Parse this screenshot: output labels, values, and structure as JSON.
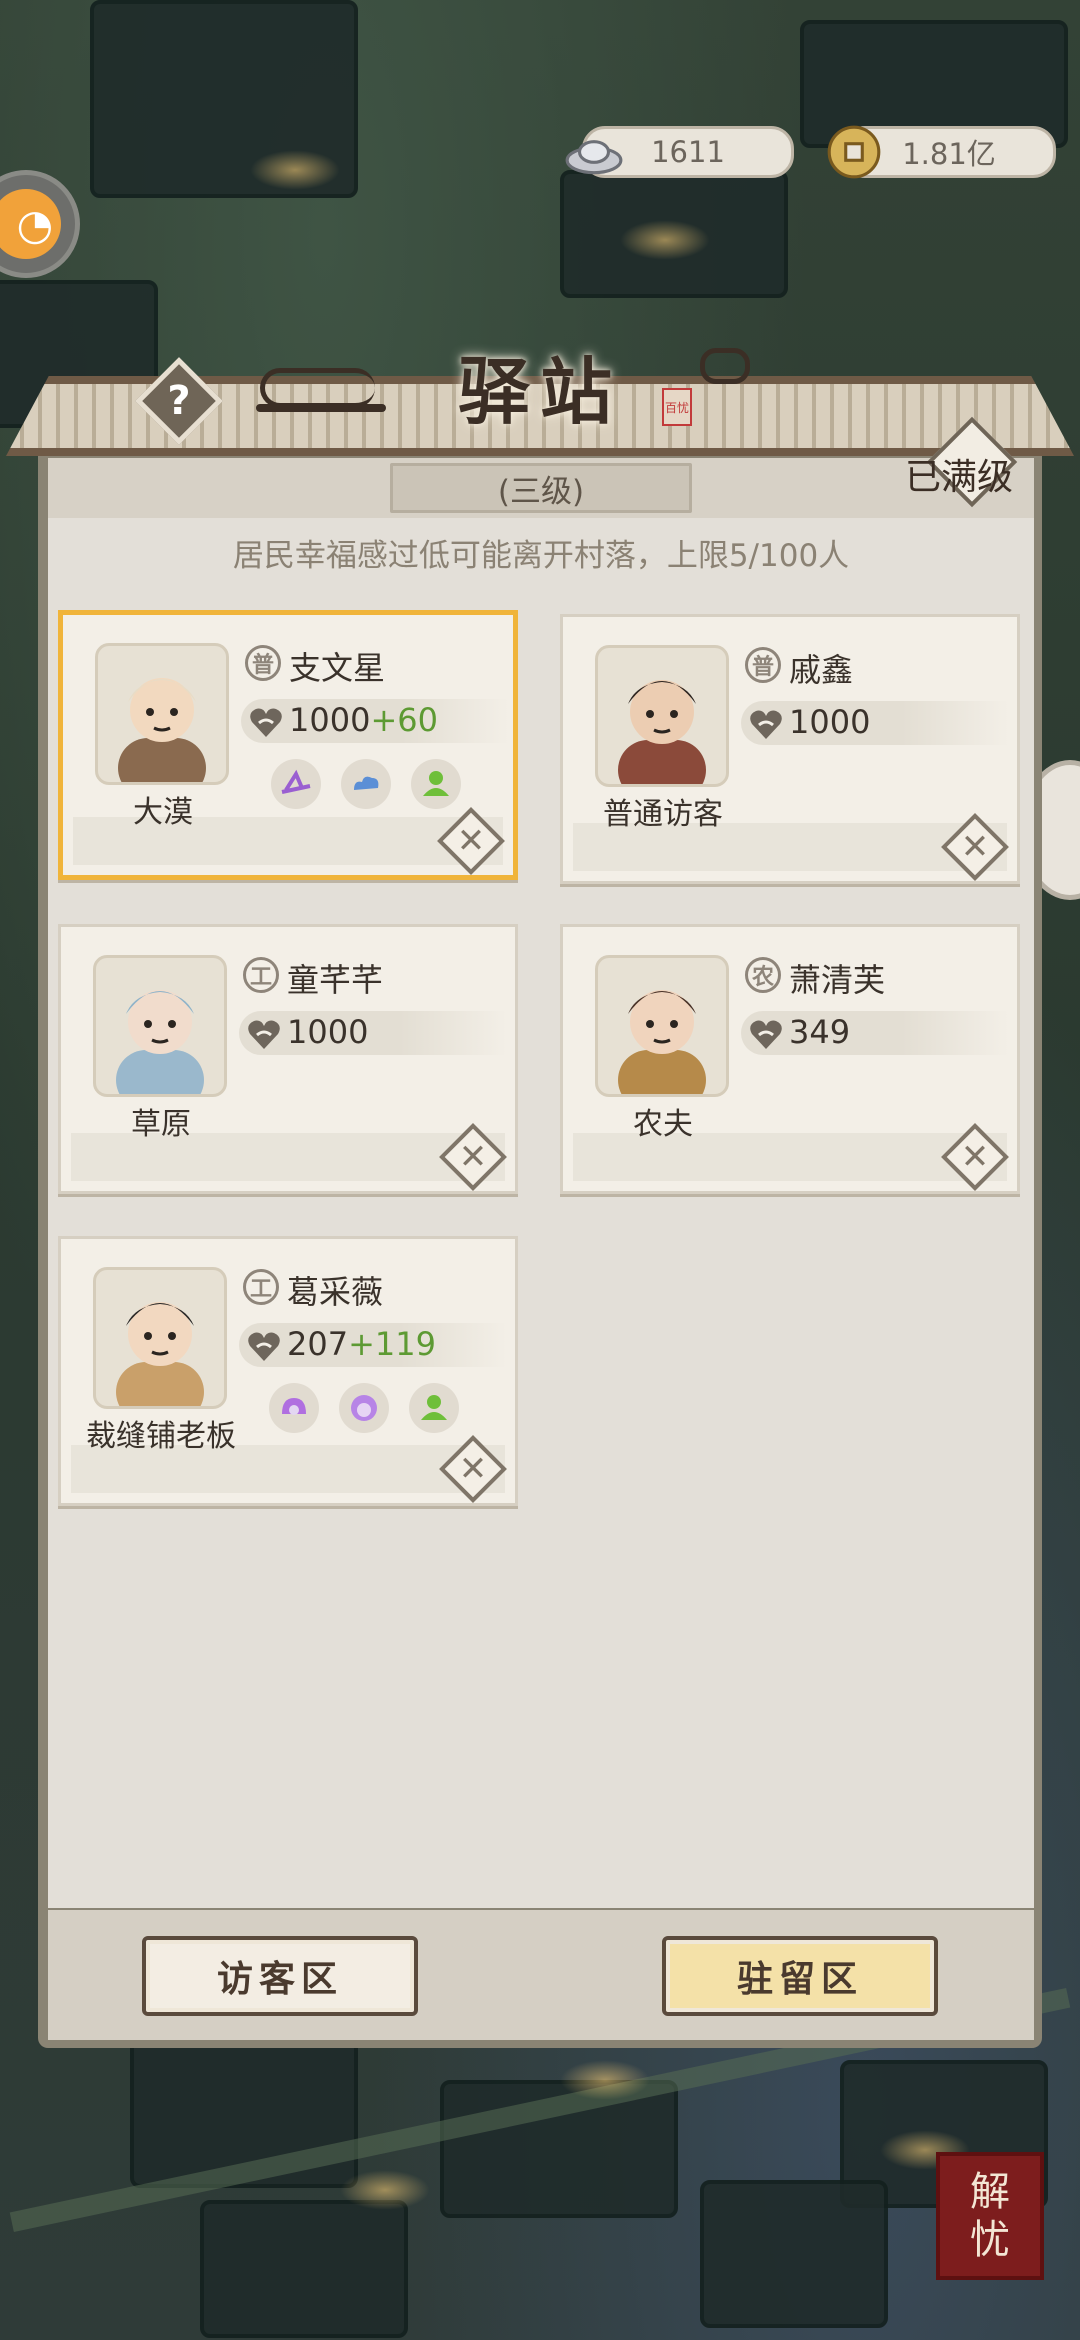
{
  "resources": {
    "silver": "1611",
    "coins": "1.81亿"
  },
  "panel": {
    "title": "驿站",
    "stamp": "百忧",
    "help": "?",
    "max_level": "已满级",
    "level": "(三级)",
    "notice": "居民幸福感过低可能离开村落，上限5/100人"
  },
  "visitors": [
    {
      "badge": "普",
      "name": "支文星",
      "happiness": "1000",
      "bonus": "+60",
      "role": "大漠",
      "selected": true,
      "traits": [
        "hat-trait-icon",
        "cloud-trait-icon",
        "figure-trait-icon"
      ]
    },
    {
      "badge": "普",
      "name": "戚鑫",
      "happiness": "1000",
      "bonus": "",
      "role": "普通访客",
      "selected": false,
      "traits": []
    },
    {
      "badge": "工",
      "name": "童芊芊",
      "happiness": "1000",
      "bonus": "",
      "role": "草原",
      "selected": false,
      "traits": []
    },
    {
      "badge": "农",
      "name": "萧清芙",
      "happiness": "349",
      "bonus": "",
      "role": "农夫",
      "selected": false,
      "traits": []
    },
    {
      "badge": "工",
      "name": "葛采薇",
      "happiness": "207",
      "bonus": "+119",
      "role": "裁缝铺老板",
      "selected": false,
      "traits": [
        "helmet-trait-icon",
        "face-trait-icon",
        "figure-trait-icon"
      ]
    }
  ],
  "buttons": {
    "visitor_area": "访客区",
    "stay_area": "驻留区"
  },
  "corner_seal": [
    "解",
    "忧"
  ],
  "colors": {
    "selected_border": "#f0b43a",
    "bonus_green": "#5d9a33",
    "stay_button": "#f4e1a8"
  }
}
